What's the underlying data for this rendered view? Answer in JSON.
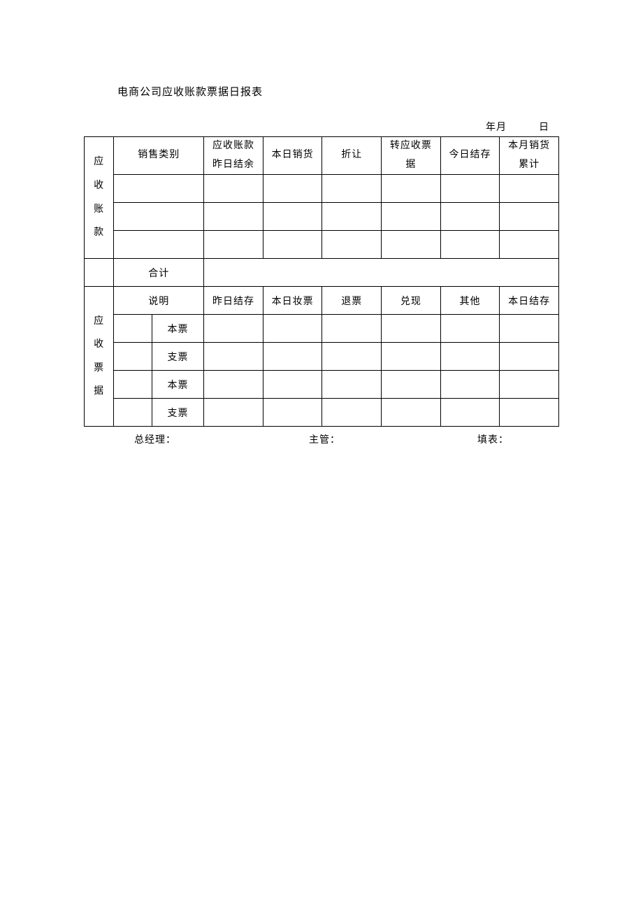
{
  "title": "电商公司应收账款票据日报表",
  "date": {
    "ym": "年月",
    "d": "日"
  },
  "section1": {
    "vlabel": "应\n收\n账\n款",
    "headers": {
      "sales_category": "销售类别",
      "prev_balance": "应收账款\n昨日结余",
      "today_sales": "本日销货",
      "discount": "折让",
      "transfer_notes": "转应收票\n据",
      "today_balance": "今日结存",
      "month_sales_cum": "本月销货\n累计"
    },
    "rows": [
      {
        "category": "",
        "prev": "",
        "sales": "",
        "discount": "",
        "transfer": "",
        "today": "",
        "cum": ""
      },
      {
        "category": "",
        "prev": "",
        "sales": "",
        "discount": "",
        "transfer": "",
        "today": "",
        "cum": ""
      },
      {
        "category": "",
        "prev": "",
        "sales": "",
        "discount": "",
        "transfer": "",
        "today": "",
        "cum": ""
      }
    ],
    "total_label": "合计",
    "total_value": ""
  },
  "section2": {
    "vlabel": "应\n收\n票\n据",
    "headers": {
      "desc": "说明",
      "prev_balance": "昨日结存",
      "today_issue": "本日妆票",
      "returned": "退票",
      "cashed": "兑现",
      "other": "其他",
      "today_balance": "本日结存"
    },
    "rows": [
      {
        "sub": "",
        "type": "本票",
        "prev": "",
        "issue": "",
        "ret": "",
        "cash": "",
        "other": "",
        "today": ""
      },
      {
        "sub": "",
        "type": "支票",
        "prev": "",
        "issue": "",
        "ret": "",
        "cash": "",
        "other": "",
        "today": ""
      },
      {
        "sub": "",
        "type": "本票",
        "prev": "",
        "issue": "",
        "ret": "",
        "cash": "",
        "other": "",
        "today": ""
      },
      {
        "sub": "",
        "type": "支票",
        "prev": "",
        "issue": "",
        "ret": "",
        "cash": "",
        "other": "",
        "today": ""
      }
    ]
  },
  "signatures": {
    "gm": "总经理：",
    "sup": "主管：",
    "prep": "填表："
  }
}
